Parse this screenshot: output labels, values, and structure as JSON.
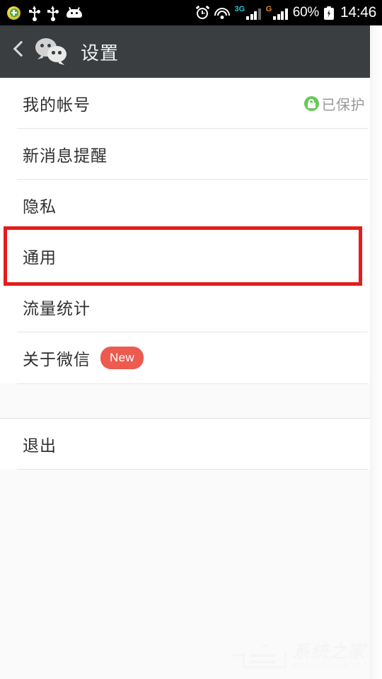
{
  "status_bar": {
    "icons_left": [
      "security-shield-icon",
      "usb-icon",
      "usb-icon",
      "android-robot-icon"
    ],
    "alarm_icon": "alarm-clock-icon",
    "wifi_icon": "wifi-icon",
    "network_1_label": "3G",
    "network_1_color": "#29c3d6",
    "network_2_label": "G",
    "network_2_color": "#e08a2b",
    "battery_percent": "60%",
    "battery_icon": "battery-charging-icon",
    "clock": "14:46",
    "background": "#000000"
  },
  "nav_bar": {
    "back_icon": "back-chevron-icon",
    "app_logo": "wechat-logo-icon",
    "title": "设置",
    "background": "#3b3e40"
  },
  "settings": {
    "group_1": [
      {
        "label": "我的帐号",
        "status_icon": "green-lock-icon",
        "status_text": "已保护",
        "badge": null,
        "highlighted": false
      },
      {
        "label": "新消息提醒",
        "status_icon": null,
        "status_text": null,
        "badge": null,
        "highlighted": false
      },
      {
        "label": "隐私",
        "status_icon": null,
        "status_text": null,
        "badge": null,
        "highlighted": false
      },
      {
        "label": "通用",
        "status_icon": null,
        "status_text": null,
        "badge": null,
        "highlighted": true
      },
      {
        "label": "流量统计",
        "status_icon": null,
        "status_text": null,
        "badge": null,
        "highlighted": false
      },
      {
        "label": "关于微信",
        "status_icon": null,
        "status_text": null,
        "badge": "New",
        "highlighted": false
      }
    ],
    "group_2": [
      {
        "label": "退出",
        "status_icon": null,
        "status_text": null,
        "badge": null,
        "highlighted": false
      }
    ],
    "badge_color": "#ec5a50",
    "highlight_color": "#e51c1c",
    "row_background": "#ffffff",
    "page_background": "#fafafa",
    "separator_color": "#e6e6e6",
    "label_color": "#2f2f2f"
  },
  "watermark": {
    "title": "系统之家",
    "subtitle": "XITONGZHIJIA.NET",
    "logo_icon": "house-logo-icon"
  }
}
